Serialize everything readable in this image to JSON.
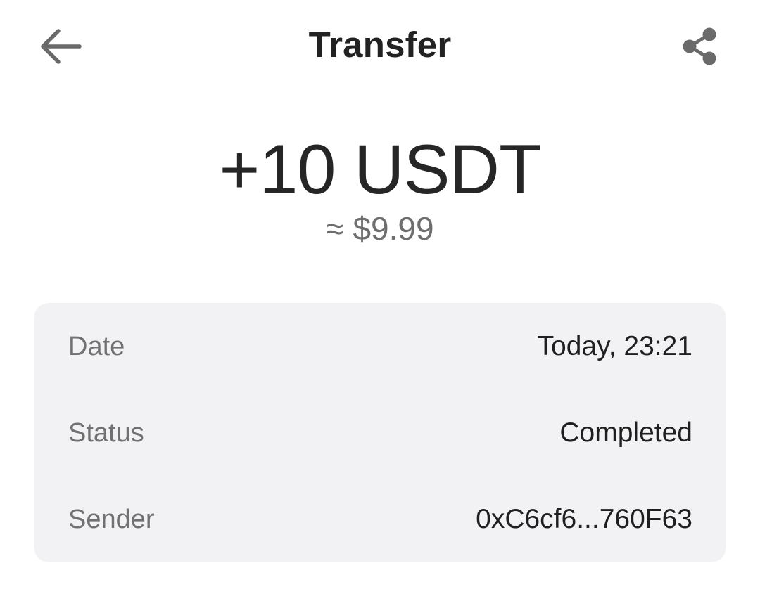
{
  "header": {
    "title": "Transfer",
    "back_icon": "arrow-left-icon",
    "share_icon": "share-icon"
  },
  "transaction": {
    "amount": "+10 USDT",
    "fiat_equivalent": "≈ $9.99"
  },
  "details": {
    "rows": [
      {
        "label": "Date",
        "value": "Today, 23:21"
      },
      {
        "label": "Status",
        "value": "Completed"
      },
      {
        "label": "Sender",
        "value": "0xC6cf6...760F63"
      }
    ]
  },
  "colors": {
    "background": "#ffffff",
    "card_background": "#f2f2f4",
    "primary_text": "#222222",
    "secondary_text": "#707070",
    "icon": "#6a6a6a"
  }
}
